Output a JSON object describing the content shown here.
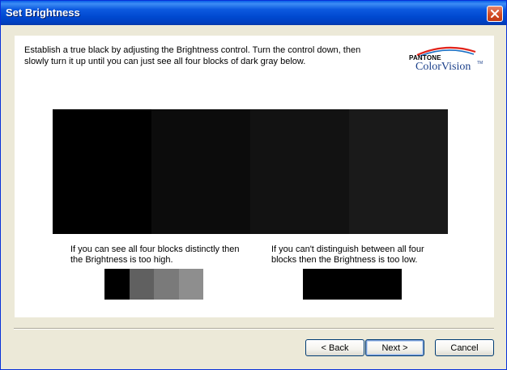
{
  "window": {
    "title": "Set Brightness"
  },
  "instructions": "Establish a true black by adjusting the Brightness control. Turn the control down, then slowly turn it up until you can just see all four blocks of dark gray below.",
  "logo": {
    "line1": "PANTONE",
    "line2": "ColorVision",
    "tm": "TM",
    "arc_colors": [
      "#e2231a",
      "#1a6fc4"
    ]
  },
  "test_pattern": {
    "blocks": [
      "#000000",
      "#0c0c0c",
      "#121212",
      "#1a1a1a"
    ]
  },
  "hints": {
    "too_high": {
      "text": "If you can see all four blocks distinctly then the Brightness is too high.",
      "blocks": [
        "#000000",
        "#606060",
        "#7a7a7a",
        "#8e8e8e"
      ]
    },
    "too_low": {
      "text": "If you can't distinguish between all four blocks then the Brightness is too low.",
      "blocks": [
        "#000000",
        "#000000"
      ]
    }
  },
  "buttons": {
    "back": "< Back",
    "next": "Next >",
    "cancel": "Cancel"
  }
}
